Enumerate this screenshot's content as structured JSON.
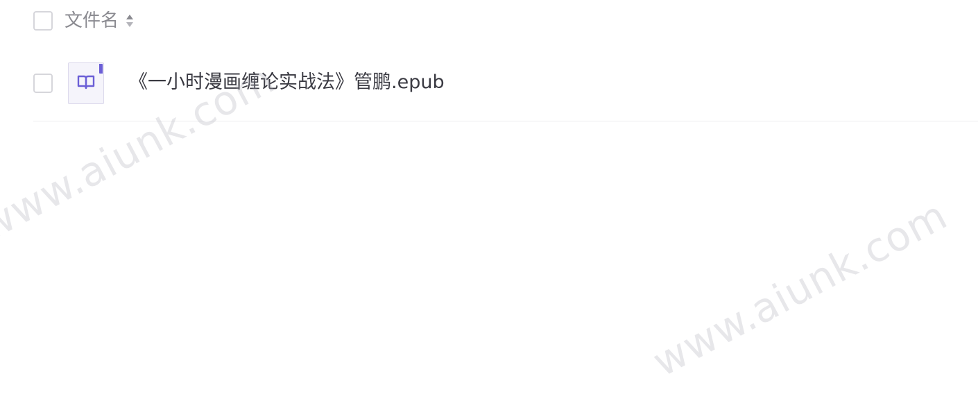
{
  "list_header": {
    "column_filename": "文件名"
  },
  "files": [
    {
      "name": "《一小时漫画缠论实战法》管鹏.epub",
      "icon": "book-icon",
      "icon_color": "#6b5fd6"
    }
  ],
  "watermark": {
    "text": "www.aiunk.com"
  }
}
